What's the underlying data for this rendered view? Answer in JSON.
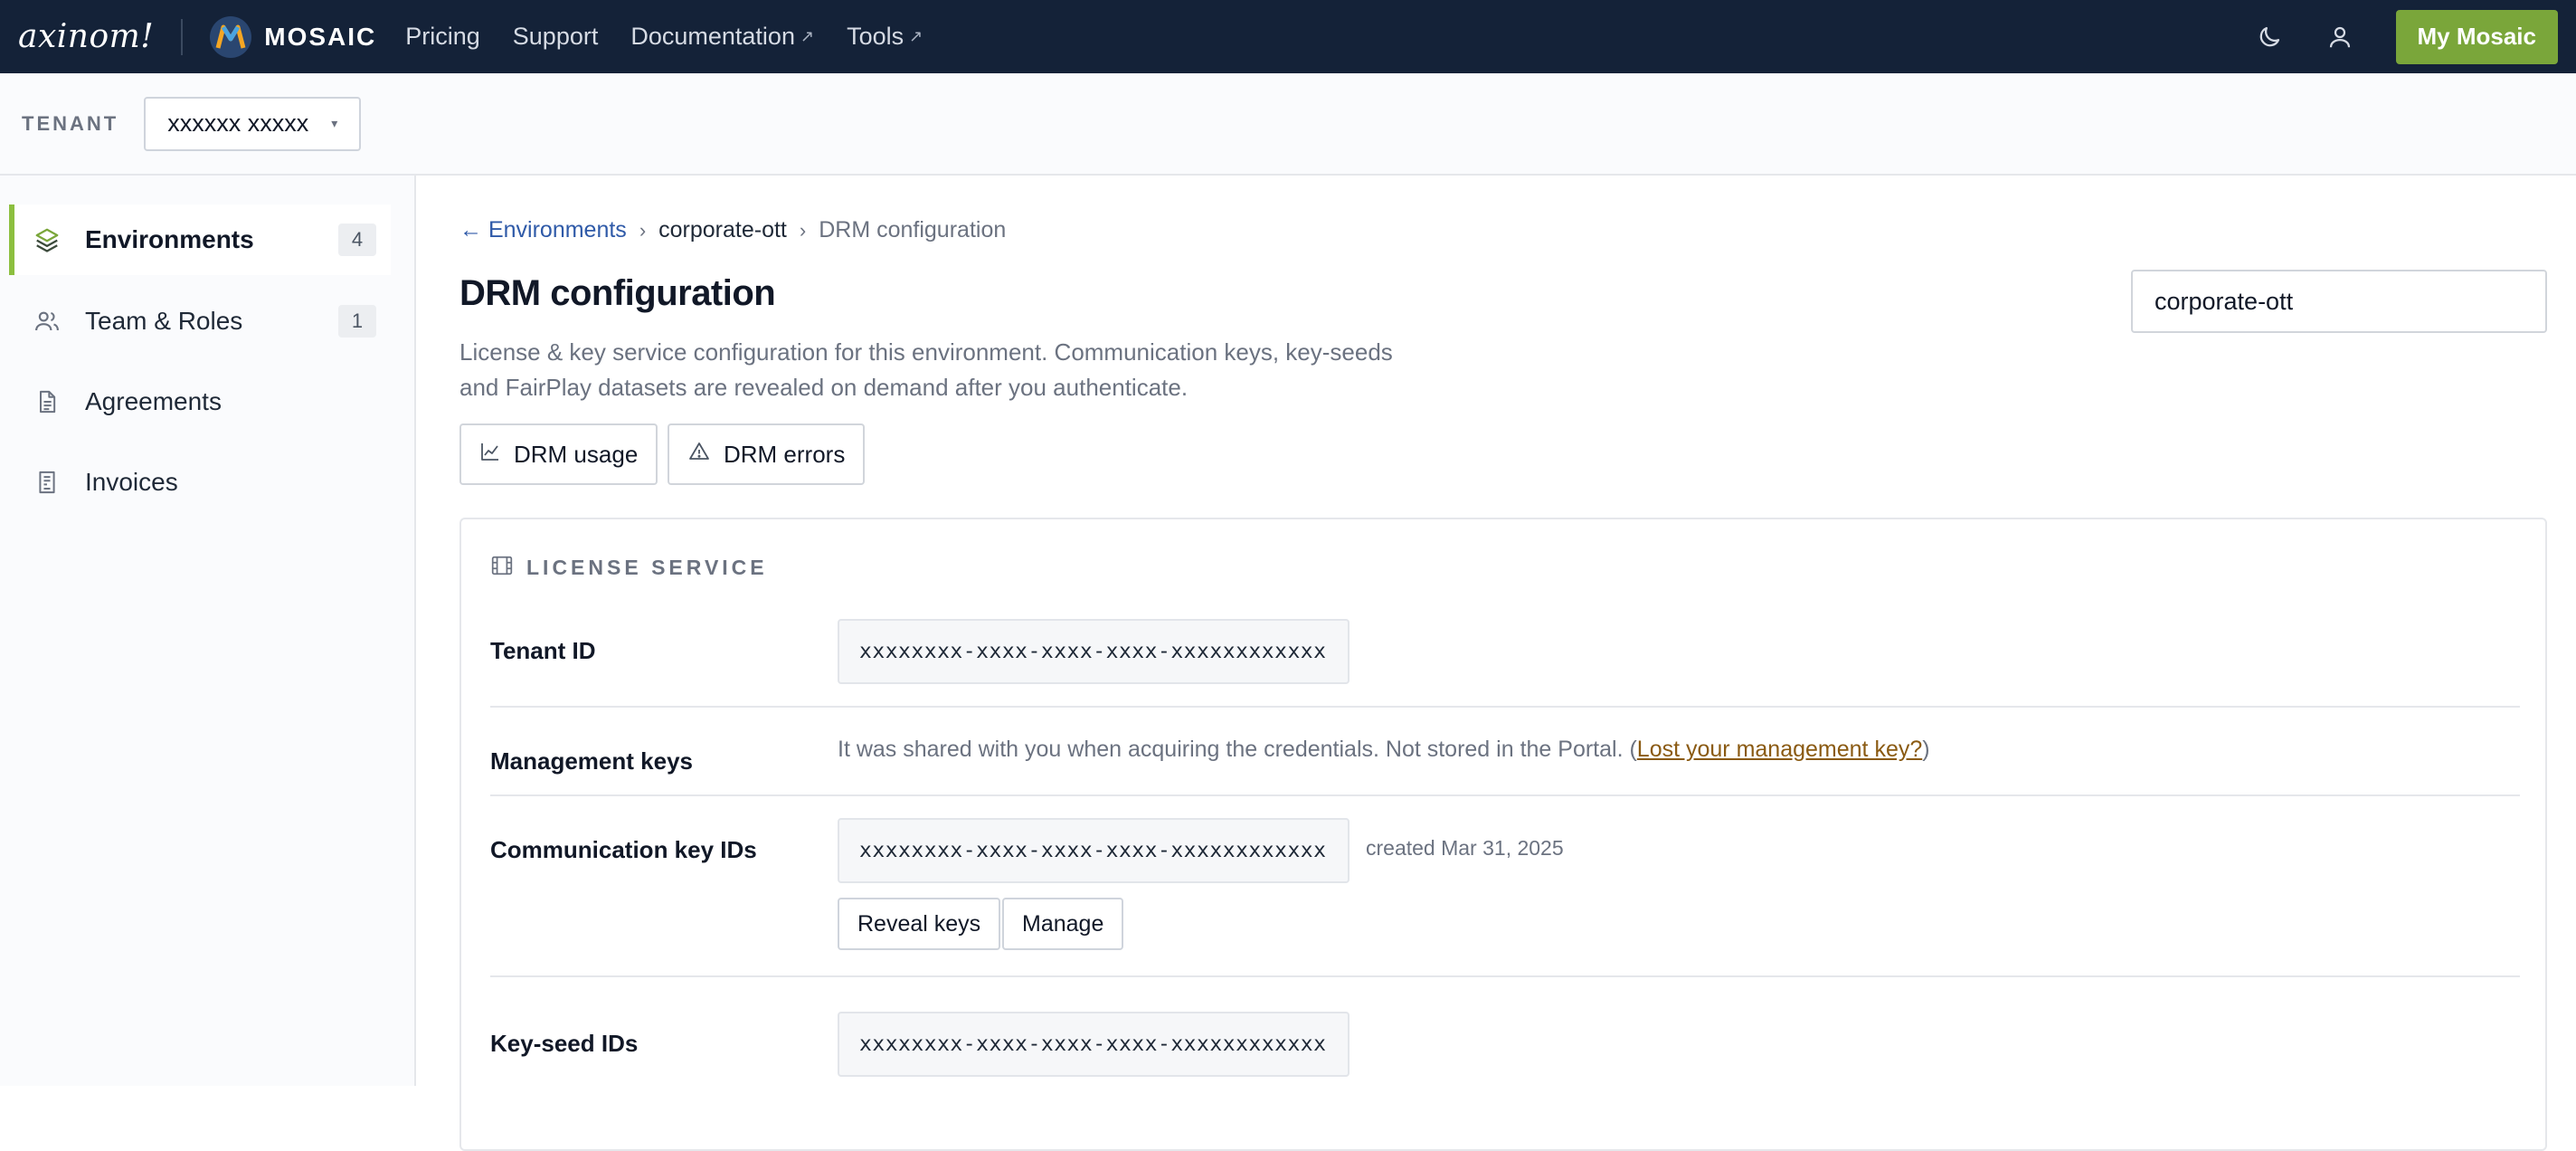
{
  "topbar": {
    "brand": "axinom!",
    "product": "MOSAIC",
    "nav": [
      {
        "label": "Pricing",
        "external": false
      },
      {
        "label": "Support",
        "external": false
      },
      {
        "label": "Documentation",
        "external": true,
        "ext_icon": "↗"
      },
      {
        "label": "Tools",
        "external": true,
        "ext_icon": "↗"
      }
    ],
    "cta_label": "My Mosaic",
    "colors": {
      "background": "#142238",
      "cta": "#7aa63a"
    }
  },
  "tenant": {
    "label": "TENANT",
    "selected": "xxxxxx xxxxx",
    "caret": "▾"
  },
  "sidebar": {
    "items": [
      {
        "label": "Environments",
        "badge": "4",
        "icon": "layers-icon",
        "active": true
      },
      {
        "label": "Team & Roles",
        "badge": "1",
        "icon": "users-icon",
        "active": false
      },
      {
        "label": "Agreements",
        "badge": "",
        "icon": "document-icon",
        "active": false
      },
      {
        "label": "Invoices",
        "badge": "",
        "icon": "receipt-icon",
        "active": false
      }
    ],
    "accent": "#8cbf3f"
  },
  "breadcrumb": {
    "back_arrow": "←",
    "back_label": "Environments",
    "sep": "›",
    "environment": "corporate-ott",
    "current": "DRM configuration"
  },
  "page": {
    "title": "DRM configuration",
    "description": "License & key service configuration for this environment. Communication keys, key-seeds and FairPlay datasets are revealed on demand after you authenticate.",
    "environment_value": "corporate-ott",
    "actions": {
      "usage_label": "DRM usage",
      "errors_label": "DRM errors"
    }
  },
  "license_service": {
    "title": "LICENSE SERVICE",
    "tenant_id": {
      "label": "Tenant ID",
      "value": "xxxxxxxx-xxxx-xxxx-xxxx-xxxxxxxxxxxx"
    },
    "management_keys": {
      "label": "Management keys",
      "text": "It was shared with you when acquiring the credentials. Not stored in the Portal. (",
      "link": "Lost your management key?",
      "close": ")"
    },
    "communication_keys": {
      "label": "Communication key IDs",
      "value": "xxxxxxxx-xxxx-xxxx-xxxx-xxxxxxxxxxxx",
      "created": "created Mar 31, 2025",
      "reveal_label": "Reveal keys",
      "manage_label": "Manage"
    },
    "key_seeds": {
      "label": "Key-seed IDs",
      "value": "xxxxxxxx-xxxx-xxxx-xxxx-xxxxxxxxxxxx"
    }
  }
}
